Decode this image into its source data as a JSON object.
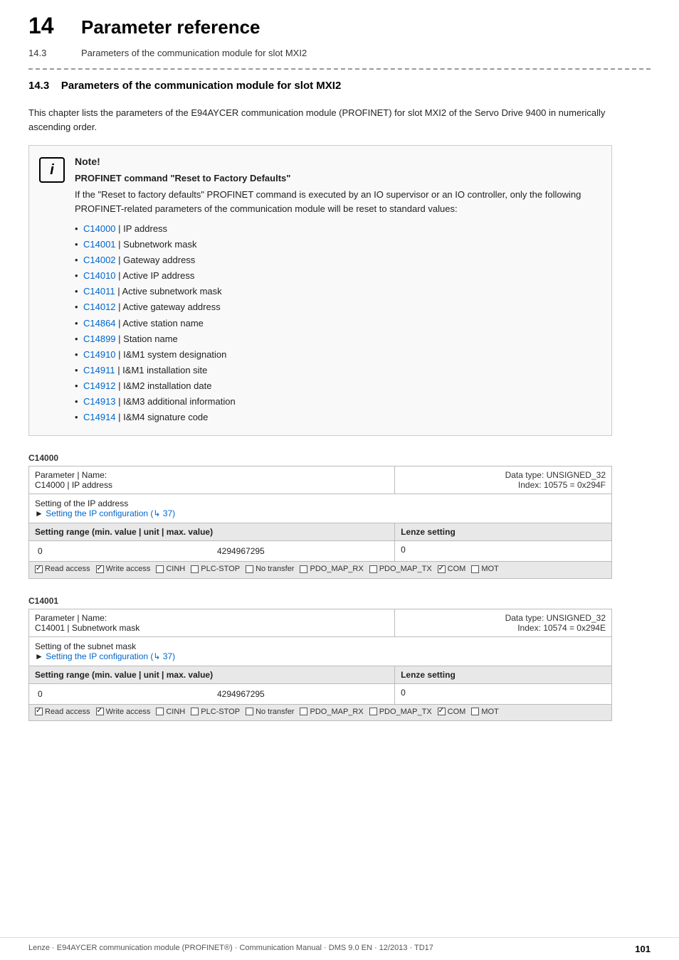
{
  "header": {
    "chapter_number": "14",
    "chapter_title": "Parameter reference",
    "sub_number": "14.3",
    "sub_title": "Parameters of the communication module for slot MXI2"
  },
  "section": {
    "number": "14.3",
    "title": "Parameters of the communication module for slot MXI2",
    "intro": "This chapter lists the parameters of the E94AYCER communication module (PROFINET) for slot MXI2 of the Servo Drive 9400 in numerically ascending order."
  },
  "note": {
    "title": "Note!",
    "subtitle": "PROFINET command \"Reset to Factory Defaults\"",
    "body": "If the \"Reset to factory defaults\" PROFINET command is executed by an IO supervisor or an IO controller, only the following PROFINET-related parameters of the communication module will be reset to standard values:",
    "items": [
      {
        "link": "C14000",
        "text": "IP address"
      },
      {
        "link": "C14001",
        "text": "Subnetwork mask"
      },
      {
        "link": "C14002",
        "text": "Gateway address"
      },
      {
        "link": "C14010",
        "text": "Active IP address"
      },
      {
        "link": "C14011",
        "text": "Active subnetwork mask"
      },
      {
        "link": "C14012",
        "text": "Active gateway address"
      },
      {
        "link": "C14864",
        "text": "Active station name"
      },
      {
        "link": "C14899",
        "text": "Station name"
      },
      {
        "link": "C14910",
        "text": "I&M1 system designation"
      },
      {
        "link": "C14911",
        "text": "I&M1 installation site"
      },
      {
        "link": "C14912",
        "text": "I&M2 installation date"
      },
      {
        "link": "C14913",
        "text": "I&M3 additional information"
      },
      {
        "link": "C14914",
        "text": "I&M4 signature code"
      }
    ]
  },
  "params": [
    {
      "id": "C14000",
      "label": "C14000",
      "name_label": "Parameter | Name:",
      "name_value": "C14000 | IP address",
      "data_type": "Data type: UNSIGNED_32",
      "index": "Index: 10575 = 0x294F",
      "description": "Setting of the IP address",
      "link_text": "Setting the IP configuration (↳ 37)",
      "range_label": "Setting range (min. value | unit | max. value)",
      "lenze_label": "Lenze setting",
      "min_value": "0",
      "max_value": "4294967295",
      "lenze_value": "0",
      "access": [
        {
          "label": "Read access",
          "checked": true
        },
        {
          "label": "Write access",
          "checked": true
        },
        {
          "label": "CINH",
          "checked": false
        },
        {
          "label": "PLC-STOP",
          "checked": false
        },
        {
          "label": "No transfer",
          "checked": false
        },
        {
          "label": "PDO_MAP_RX",
          "checked": false
        },
        {
          "label": "PDO_MAP_TX",
          "checked": false
        },
        {
          "label": "COM",
          "checked": true
        },
        {
          "label": "MOT",
          "checked": false
        }
      ]
    },
    {
      "id": "C14001",
      "label": "C14001",
      "name_label": "Parameter | Name:",
      "name_value": "C14001 | Subnetwork mask",
      "data_type": "Data type: UNSIGNED_32",
      "index": "Index: 10574 = 0x294E",
      "description": "Setting of the subnet mask",
      "link_text": "Setting the IP configuration (↳ 37)",
      "range_label": "Setting range (min. value | unit | max. value)",
      "lenze_label": "Lenze setting",
      "min_value": "0",
      "max_value": "4294967295",
      "lenze_value": "0",
      "access": [
        {
          "label": "Read access",
          "checked": true
        },
        {
          "label": "Write access",
          "checked": true
        },
        {
          "label": "CINH",
          "checked": false
        },
        {
          "label": "PLC-STOP",
          "checked": false
        },
        {
          "label": "No transfer",
          "checked": false
        },
        {
          "label": "PDO_MAP_RX",
          "checked": false
        },
        {
          "label": "PDO_MAP_TX",
          "checked": false
        },
        {
          "label": "COM",
          "checked": true
        },
        {
          "label": "MOT",
          "checked": false
        }
      ]
    }
  ],
  "footer": {
    "left": "Lenze · E94AYCER communication module (PROFINET®) · Communication Manual · DMS 9.0 EN · 12/2013 · TD17",
    "right": "101"
  }
}
